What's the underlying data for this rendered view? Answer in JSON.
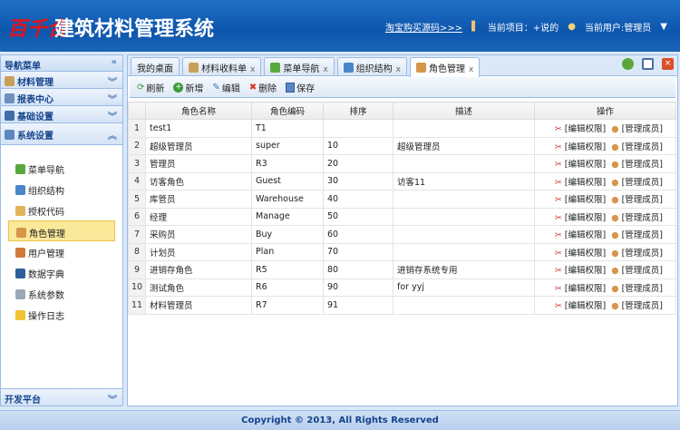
{
  "header": {
    "logo_mark": "百千合",
    "title": "建筑材料管理系统",
    "buy_link": "淘宝购买源码>>>",
    "project": "当前项目：+说的",
    "user": "当前用户:管理员"
  },
  "sidebar": {
    "title": "导航菜单",
    "sections": [
      "材料管理",
      "报表中心",
      "基础设置",
      "系统设置"
    ],
    "items": [
      "菜单导航",
      "组织结构",
      "授权代码",
      "角色管理",
      "用户管理",
      "数据字典",
      "系统参数",
      "操作日志"
    ],
    "footer": "开发平台"
  },
  "tabs": [
    {
      "label": "我的桌面"
    },
    {
      "label": "材料收料单"
    },
    {
      "label": "菜单导航"
    },
    {
      "label": "组织结构"
    },
    {
      "label": "角色管理"
    }
  ],
  "toolbar": {
    "refresh": "刷新",
    "add": "新增",
    "edit": "编辑",
    "delete": "删除",
    "save": "保存"
  },
  "table": {
    "headers": [
      "角色名称",
      "角色编码",
      "排序",
      "描述",
      "操作"
    ],
    "edit_perm": "[编辑权限]",
    "manage_members": "[管理成员]",
    "rows": [
      [
        "1",
        "test1",
        "T1",
        "",
        ""
      ],
      [
        "2",
        "超级管理员",
        "super",
        "10",
        "超级管理员"
      ],
      [
        "3",
        "管理员",
        "R3",
        "20",
        ""
      ],
      [
        "4",
        "访客角色",
        "Guest",
        "30",
        "访客11"
      ],
      [
        "5",
        "库管员",
        "Warehouse",
        "40",
        ""
      ],
      [
        "6",
        "经理",
        "Manage",
        "50",
        ""
      ],
      [
        "7",
        "采购员",
        "Buy",
        "60",
        ""
      ],
      [
        "8",
        "计划员",
        "Plan",
        "70",
        ""
      ],
      [
        "9",
        "进销存角色",
        "R5",
        "80",
        "进销存系统专用"
      ],
      [
        "10",
        "测试角色",
        "R6",
        "90",
        "for yyj"
      ],
      [
        "11",
        "材料管理员",
        "R7",
        "91",
        ""
      ]
    ]
  },
  "footer": "Copyright © 2013, All Rights Reserved"
}
